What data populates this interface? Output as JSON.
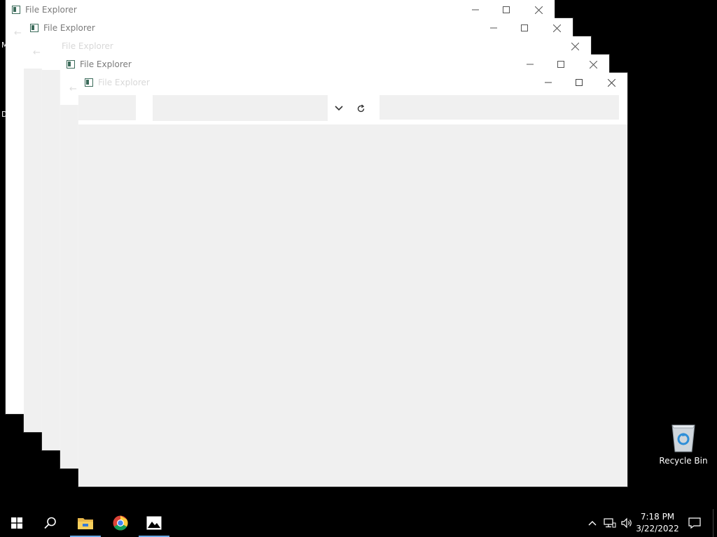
{
  "windows": [
    {
      "title": "File Explorer"
    },
    {
      "title": "File Explorer"
    },
    {
      "title": "File Explorer"
    },
    {
      "title": "File Explorer"
    },
    {
      "title": "File Explorer"
    }
  ],
  "edge_letters": [
    "M",
    "D"
  ],
  "desktop": {
    "recycle_bin_label": "Recycle Bin"
  },
  "taskbar": {
    "icons": [
      "windows-start-icon",
      "search-icon",
      "file-explorer-icon",
      "chrome-icon",
      "photos-icon"
    ],
    "tray_icons": [
      "chevron-up-icon",
      "network-icon",
      "volume-icon"
    ],
    "time": "7:18 PM",
    "date": "3/22/2022"
  },
  "colors": {
    "desktop_bg": "#000000",
    "window_bg": "#ffffff",
    "content_bg": "#f0f0f0",
    "taskbar_accent": "#6aa9e6"
  }
}
